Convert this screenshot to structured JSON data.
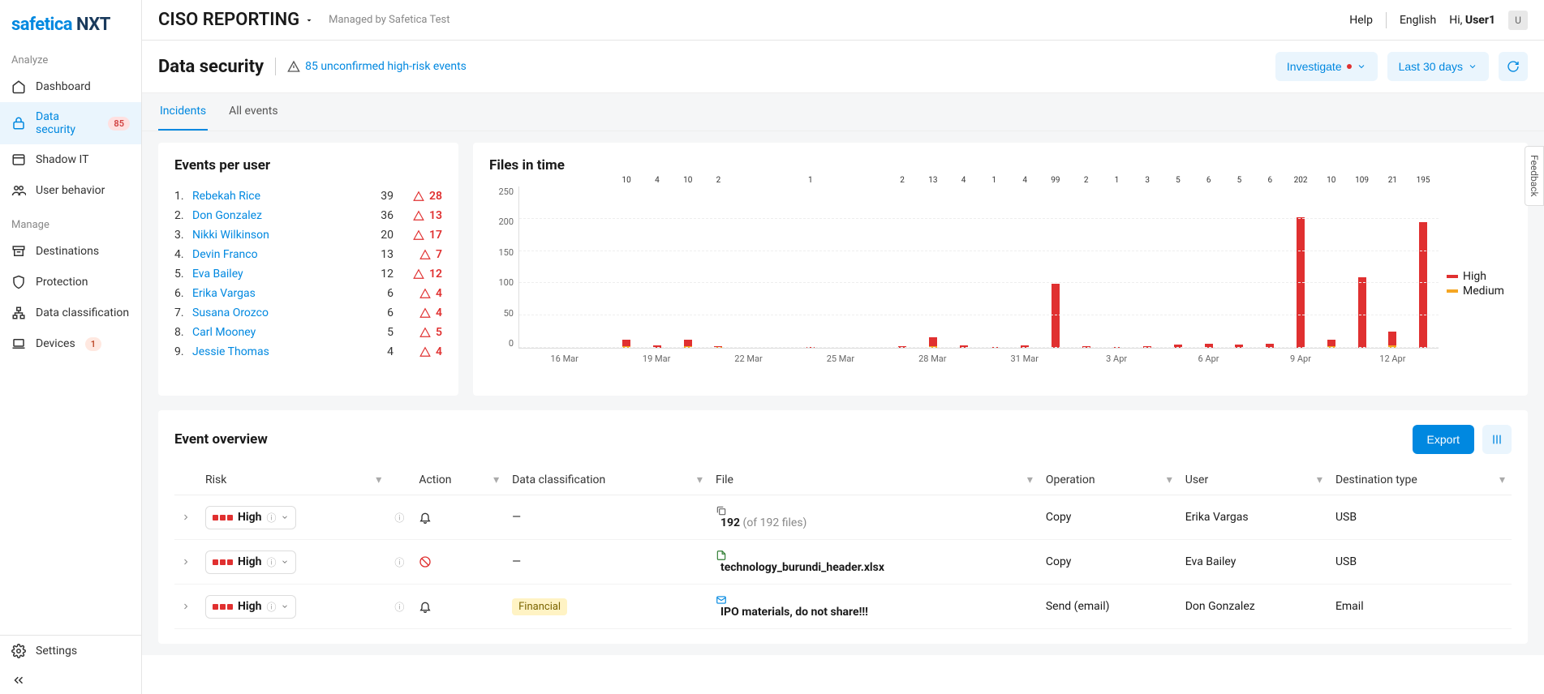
{
  "logo": {
    "part1": "safetica",
    "part2": " NXT"
  },
  "topbar": {
    "title": "CISO REPORTING",
    "managed_by": "Managed by Safetica Test",
    "help": "Help",
    "language": "English",
    "greeting_prefix": "Hi, ",
    "username": "User1",
    "avatar_initial": "U"
  },
  "sidebar": {
    "section_analyze": "Analyze",
    "section_manage": "Manage",
    "items": [
      {
        "label": "Dashboard"
      },
      {
        "label": "Data security",
        "badge": "85",
        "active": true
      },
      {
        "label": "Shadow IT"
      },
      {
        "label": "User behavior"
      },
      {
        "label": "Destinations"
      },
      {
        "label": "Protection"
      },
      {
        "label": "Data classification"
      },
      {
        "label": "Devices",
        "badge": "1"
      }
    ],
    "settings": "Settings"
  },
  "subheader": {
    "page_title": "Data security",
    "alert_text": "85 unconfirmed high-risk events",
    "investigate": "Investigate",
    "daterange": "Last 30 days"
  },
  "tabs": {
    "incidents": "Incidents",
    "all_events": "All events"
  },
  "events_per_user": {
    "title": "Events per user",
    "rows": [
      {
        "rank": "1.",
        "name": "Rebekah Rice",
        "count": "39",
        "risk": "28"
      },
      {
        "rank": "2.",
        "name": "Don Gonzalez",
        "count": "36",
        "risk": "13"
      },
      {
        "rank": "3.",
        "name": "Nikki Wilkinson",
        "count": "20",
        "risk": "17"
      },
      {
        "rank": "4.",
        "name": "Devin Franco",
        "count": "13",
        "risk": "7"
      },
      {
        "rank": "5.",
        "name": "Eva Bailey",
        "count": "12",
        "risk": "12"
      },
      {
        "rank": "6.",
        "name": "Erika Vargas",
        "count": "6",
        "risk": "4"
      },
      {
        "rank": "7.",
        "name": "Susana Orozco",
        "count": "6",
        "risk": "4"
      },
      {
        "rank": "8.",
        "name": "Carl Mooney",
        "count": "5",
        "risk": "5"
      },
      {
        "rank": "9.",
        "name": "Jessie Thomas",
        "count": "4",
        "risk": "4"
      }
    ]
  },
  "chart_data": {
    "type": "bar",
    "title": "Files in time",
    "ylabel": "",
    "ylim": [
      0,
      250
    ],
    "yticks": [
      "250",
      "200",
      "150",
      "100",
      "50",
      "0"
    ],
    "categories": [
      "16 Mar",
      "17 Mar",
      "18 Mar",
      "19 Mar",
      "20 Mar",
      "21 Mar",
      "22 Mar",
      "23 Mar",
      "24 Mar",
      "25 Mar",
      "26 Mar",
      "27 Mar",
      "28 Mar",
      "29 Mar",
      "30 Mar",
      "31 Mar",
      "1 Apr",
      "2 Apr",
      "3 Apr",
      "4 Apr",
      "5 Apr",
      "6 Apr",
      "7 Apr",
      "8 Apr",
      "9 Apr",
      "10 Apr",
      "11 Apr",
      "12 Apr",
      "13 Apr"
    ],
    "x_tick_labels": [
      "16 Mar",
      "19 Mar",
      "22 Mar",
      "25 Mar",
      "28 Mar",
      "31 Mar",
      "3 Apr",
      "6 Apr",
      "9 Apr",
      "12 Apr"
    ],
    "series": [
      {
        "name": "High",
        "color": "#e03030",
        "values": [
          0,
          0,
          0,
          10,
          4,
          10,
          2,
          0,
          0,
          1,
          0,
          0,
          2,
          13,
          4,
          1,
          4,
          99,
          2,
          1,
          3,
          5,
          6,
          5,
          6,
          202,
          10,
          109,
          21,
          195
        ]
      },
      {
        "name": "Medium",
        "color": "#f5a623",
        "values": [
          0,
          0,
          0,
          3,
          0,
          2,
          1,
          0,
          0,
          0,
          0,
          0,
          0,
          3,
          0,
          0,
          0,
          0,
          0,
          0,
          0,
          0,
          0,
          0,
          0,
          0,
          2,
          0,
          4,
          0
        ]
      }
    ],
    "legend": {
      "high": "High",
      "medium": "Medium"
    }
  },
  "overview": {
    "title": "Event overview",
    "export": "Export",
    "columns": {
      "risk": "Risk",
      "action": "Action",
      "dc": "Data classification",
      "file": "File",
      "operation": "Operation",
      "user": "User",
      "dest": "Destination type"
    },
    "rows": [
      {
        "risk": "High",
        "action": "bell",
        "dc": "—",
        "file_count": "192",
        "file_suffix": " (of 192 files)",
        "file_icon": "copy",
        "operation": "Copy",
        "user": "Erika Vargas",
        "dest": "USB"
      },
      {
        "risk": "High",
        "action": "block",
        "dc": "—",
        "file": "technology_burundi_header.xlsx",
        "file_icon": "xls",
        "operation": "Copy",
        "user": "Eva Bailey",
        "dest": "USB"
      },
      {
        "risk": "High",
        "action": "bell",
        "dc": "Financial",
        "file": "IPO materials, do not share!!!",
        "file_icon": "mail",
        "operation": "Send (email)",
        "user": "Don Gonzalez",
        "dest": "Email"
      }
    ]
  },
  "feedback": "Feedback"
}
